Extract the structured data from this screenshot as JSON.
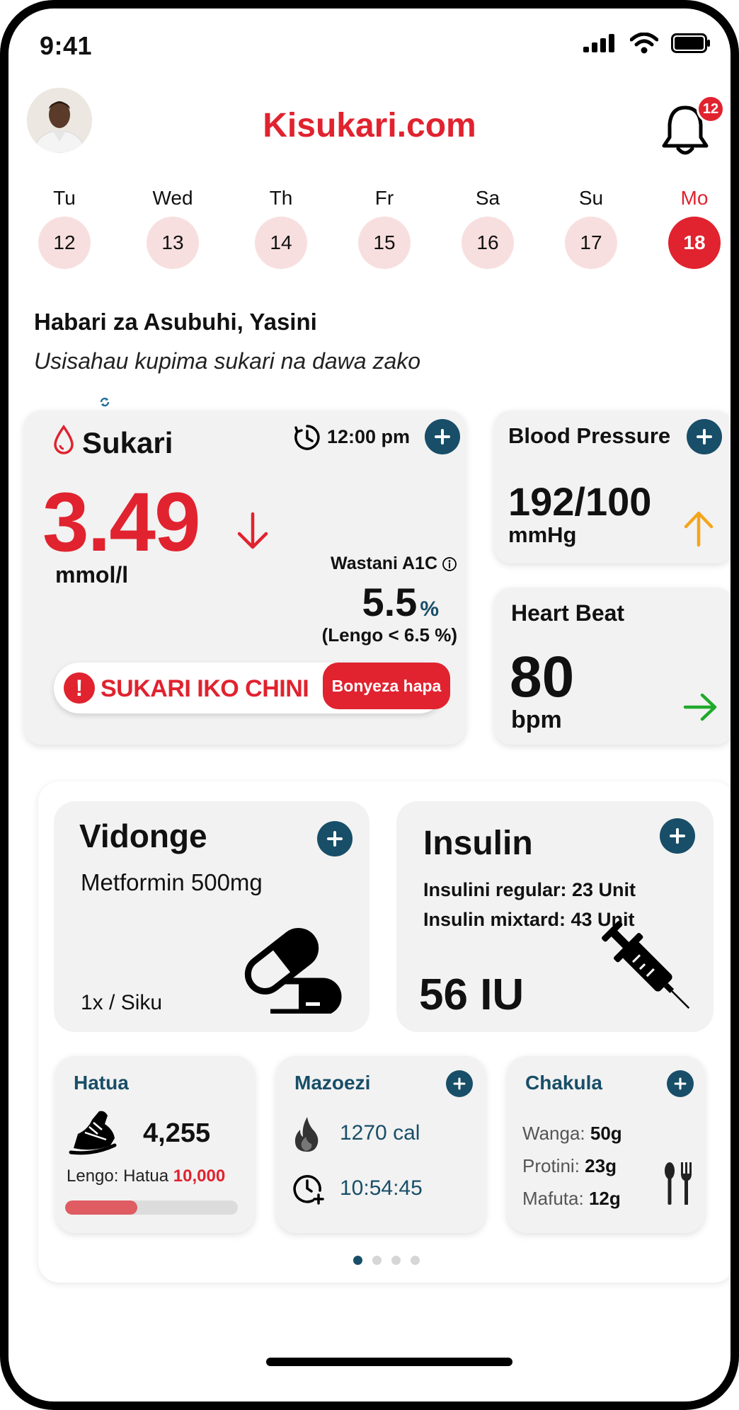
{
  "status_bar": {
    "time": "9:41"
  },
  "header": {
    "app_title": "Kisukari.com",
    "notification_count": "12"
  },
  "days": [
    {
      "name": "Tu",
      "date": "12"
    },
    {
      "name": "Wed",
      "date": "13"
    },
    {
      "name": "Th",
      "date": "14"
    },
    {
      "name": "Fr",
      "date": "15"
    },
    {
      "name": "Sa",
      "date": "16"
    },
    {
      "name": "Su",
      "date": "17"
    },
    {
      "name": "Mo",
      "date": "18",
      "selected": true
    }
  ],
  "greeting": "Habari za Asubuhi, Yasini",
  "reminder": "Usisahau kupima sukari na dawa zako",
  "sukari": {
    "title": "Sukari",
    "time": "12:00 pm",
    "value": "3.49",
    "unit": "mmol/l",
    "trend": "down",
    "a1c_label": "Wastani A1C",
    "a1c_value": "5.5",
    "a1c_unit": "%",
    "a1c_target": "(Lengo < 6.5 %)",
    "alert_icon": "!",
    "alert_text": "SUKARI IKO CHINI",
    "alert_button": "Bonyeza hapa"
  },
  "blood_pressure": {
    "title": "Blood Pressure",
    "value": "192/100",
    "unit": "mmHg",
    "trend": "up"
  },
  "heart_beat": {
    "title": "Heart Beat",
    "value": "80",
    "unit": "bpm",
    "trend": "steady"
  },
  "vidonge": {
    "title": "Vidonge",
    "drug": "Metformin 500mg",
    "frequency": "1x / Siku"
  },
  "insulin": {
    "title": "Insulin",
    "line1": "Insulini regular: 23 Unit",
    "line2": "Insulin mixtard: 43 Unit",
    "total": "56 IU"
  },
  "hatua": {
    "title": "Hatua",
    "steps": "4,255",
    "goal_label": "Lengo: Hatua",
    "goal_value": "10,000",
    "progress": 0.42
  },
  "mazoezi": {
    "title": "Mazoezi",
    "calories": "1270 cal",
    "duration": "10:54:45"
  },
  "chakula": {
    "title": "Chakula",
    "rows": [
      {
        "label": "Wanga:",
        "value": "50g"
      },
      {
        "label": "Protini:",
        "value": "23g"
      },
      {
        "label": "Mafuta:",
        "value": "12g"
      }
    ]
  },
  "pagination": {
    "pages": 4,
    "active": 0
  },
  "colors": {
    "brand_red": "#e0232f",
    "accent_teal": "#184e68",
    "day_pink": "#f8dfdf",
    "card_bg": "#f2f2f2",
    "trend_up": "#f5a51b",
    "trend_steady": "#1faa2b"
  },
  "icons": [
    "signal-icon",
    "wifi-icon",
    "battery-icon",
    "bell-icon",
    "drop-icon",
    "clock-icon",
    "down-arrow-icon",
    "info-icon",
    "up-arrow-icon",
    "right-arrow-icon",
    "plus-icon",
    "pill-icon",
    "syringe-icon",
    "shoe-icon",
    "flame-icon",
    "timer-icon",
    "cutlery-icon"
  ]
}
